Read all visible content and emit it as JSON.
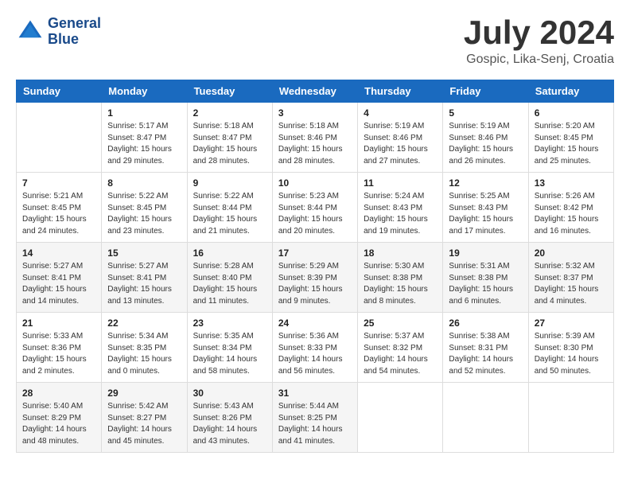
{
  "header": {
    "logo_line1": "General",
    "logo_line2": "Blue",
    "month_year": "July 2024",
    "location": "Gospic, Lika-Senj, Croatia"
  },
  "weekdays": [
    "Sunday",
    "Monday",
    "Tuesday",
    "Wednesday",
    "Thursday",
    "Friday",
    "Saturday"
  ],
  "weeks": [
    [
      {
        "day": "",
        "info": ""
      },
      {
        "day": "1",
        "info": "Sunrise: 5:17 AM\nSunset: 8:47 PM\nDaylight: 15 hours\nand 29 minutes."
      },
      {
        "day": "2",
        "info": "Sunrise: 5:18 AM\nSunset: 8:47 PM\nDaylight: 15 hours\nand 28 minutes."
      },
      {
        "day": "3",
        "info": "Sunrise: 5:18 AM\nSunset: 8:46 PM\nDaylight: 15 hours\nand 28 minutes."
      },
      {
        "day": "4",
        "info": "Sunrise: 5:19 AM\nSunset: 8:46 PM\nDaylight: 15 hours\nand 27 minutes."
      },
      {
        "day": "5",
        "info": "Sunrise: 5:19 AM\nSunset: 8:46 PM\nDaylight: 15 hours\nand 26 minutes."
      },
      {
        "day": "6",
        "info": "Sunrise: 5:20 AM\nSunset: 8:45 PM\nDaylight: 15 hours\nand 25 minutes."
      }
    ],
    [
      {
        "day": "7",
        "info": "Sunrise: 5:21 AM\nSunset: 8:45 PM\nDaylight: 15 hours\nand 24 minutes."
      },
      {
        "day": "8",
        "info": "Sunrise: 5:22 AM\nSunset: 8:45 PM\nDaylight: 15 hours\nand 23 minutes."
      },
      {
        "day": "9",
        "info": "Sunrise: 5:22 AM\nSunset: 8:44 PM\nDaylight: 15 hours\nand 21 minutes."
      },
      {
        "day": "10",
        "info": "Sunrise: 5:23 AM\nSunset: 8:44 PM\nDaylight: 15 hours\nand 20 minutes."
      },
      {
        "day": "11",
        "info": "Sunrise: 5:24 AM\nSunset: 8:43 PM\nDaylight: 15 hours\nand 19 minutes."
      },
      {
        "day": "12",
        "info": "Sunrise: 5:25 AM\nSunset: 8:43 PM\nDaylight: 15 hours\nand 17 minutes."
      },
      {
        "day": "13",
        "info": "Sunrise: 5:26 AM\nSunset: 8:42 PM\nDaylight: 15 hours\nand 16 minutes."
      }
    ],
    [
      {
        "day": "14",
        "info": "Sunrise: 5:27 AM\nSunset: 8:41 PM\nDaylight: 15 hours\nand 14 minutes."
      },
      {
        "day": "15",
        "info": "Sunrise: 5:27 AM\nSunset: 8:41 PM\nDaylight: 15 hours\nand 13 minutes."
      },
      {
        "day": "16",
        "info": "Sunrise: 5:28 AM\nSunset: 8:40 PM\nDaylight: 15 hours\nand 11 minutes."
      },
      {
        "day": "17",
        "info": "Sunrise: 5:29 AM\nSunset: 8:39 PM\nDaylight: 15 hours\nand 9 minutes."
      },
      {
        "day": "18",
        "info": "Sunrise: 5:30 AM\nSunset: 8:38 PM\nDaylight: 15 hours\nand 8 minutes."
      },
      {
        "day": "19",
        "info": "Sunrise: 5:31 AM\nSunset: 8:38 PM\nDaylight: 15 hours\nand 6 minutes."
      },
      {
        "day": "20",
        "info": "Sunrise: 5:32 AM\nSunset: 8:37 PM\nDaylight: 15 hours\nand 4 minutes."
      }
    ],
    [
      {
        "day": "21",
        "info": "Sunrise: 5:33 AM\nSunset: 8:36 PM\nDaylight: 15 hours\nand 2 minutes."
      },
      {
        "day": "22",
        "info": "Sunrise: 5:34 AM\nSunset: 8:35 PM\nDaylight: 15 hours\nand 0 minutes."
      },
      {
        "day": "23",
        "info": "Sunrise: 5:35 AM\nSunset: 8:34 PM\nDaylight: 14 hours\nand 58 minutes."
      },
      {
        "day": "24",
        "info": "Sunrise: 5:36 AM\nSunset: 8:33 PM\nDaylight: 14 hours\nand 56 minutes."
      },
      {
        "day": "25",
        "info": "Sunrise: 5:37 AM\nSunset: 8:32 PM\nDaylight: 14 hours\nand 54 minutes."
      },
      {
        "day": "26",
        "info": "Sunrise: 5:38 AM\nSunset: 8:31 PM\nDaylight: 14 hours\nand 52 minutes."
      },
      {
        "day": "27",
        "info": "Sunrise: 5:39 AM\nSunset: 8:30 PM\nDaylight: 14 hours\nand 50 minutes."
      }
    ],
    [
      {
        "day": "28",
        "info": "Sunrise: 5:40 AM\nSunset: 8:29 PM\nDaylight: 14 hours\nand 48 minutes."
      },
      {
        "day": "29",
        "info": "Sunrise: 5:42 AM\nSunset: 8:27 PM\nDaylight: 14 hours\nand 45 minutes."
      },
      {
        "day": "30",
        "info": "Sunrise: 5:43 AM\nSunset: 8:26 PM\nDaylight: 14 hours\nand 43 minutes."
      },
      {
        "day": "31",
        "info": "Sunrise: 5:44 AM\nSunset: 8:25 PM\nDaylight: 14 hours\nand 41 minutes."
      },
      {
        "day": "",
        "info": ""
      },
      {
        "day": "",
        "info": ""
      },
      {
        "day": "",
        "info": ""
      }
    ]
  ]
}
